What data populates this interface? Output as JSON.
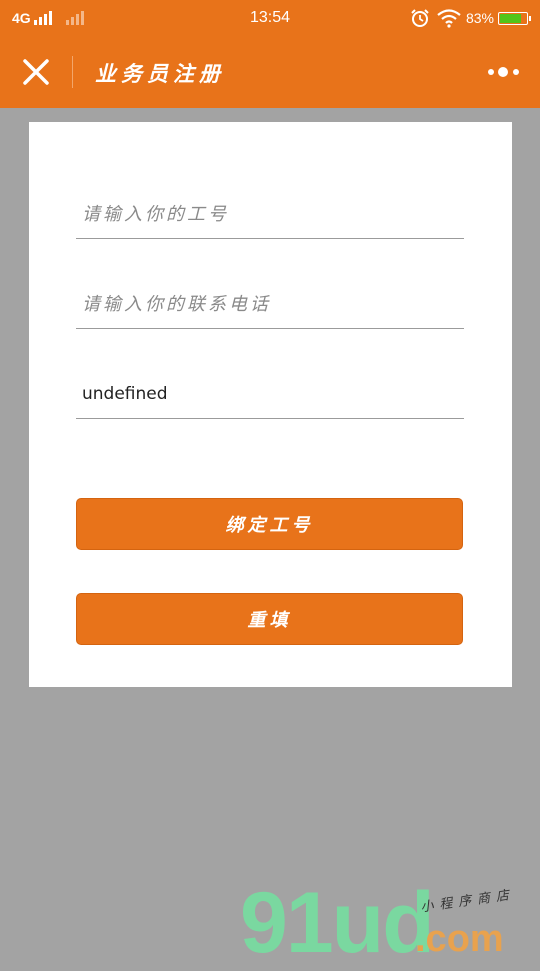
{
  "status_bar": {
    "network": "4G",
    "time": "13:54",
    "battery_percent": "83%",
    "battery_level": 0.83
  },
  "nav": {
    "title": "业务员注册",
    "close_icon": "close-icon",
    "more_icon": "more-dots-icon"
  },
  "form": {
    "employee_id": {
      "placeholder": "请输入你的工号",
      "value": ""
    },
    "phone": {
      "placeholder": "请输入你的联系电话",
      "value": ""
    },
    "third_field": {
      "value": "undefined"
    },
    "bind_button_label": "绑定工号",
    "reset_button_label": "重填"
  },
  "watermark": {
    "main": "91ud",
    "suffix": ".com",
    "sub": "小程序商店"
  },
  "colors": {
    "accent": "#e8731a",
    "overlay": "#a3a3a3",
    "card": "#ffffff"
  }
}
